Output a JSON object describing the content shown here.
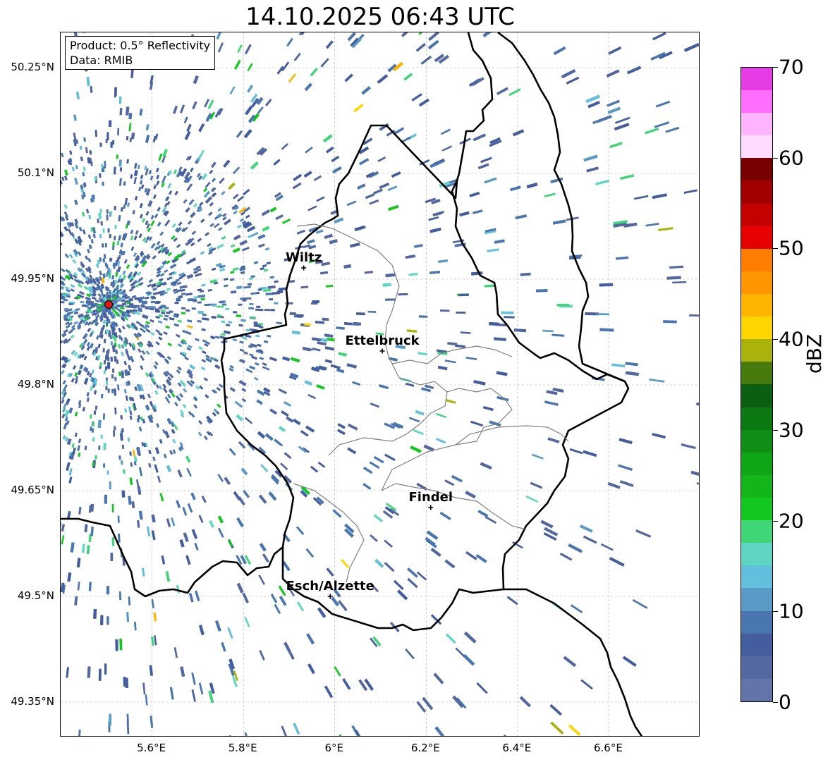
{
  "title": "14.10.2025 06:43 UTC",
  "info": {
    "product": "Product: 0.5° Reflectivity",
    "data": "Data: RMIB"
  },
  "map": {
    "lon_range": [
      5.4,
      6.8
    ],
    "lat_range": [
      49.3,
      50.3
    ],
    "lat_ticks": [
      {
        "value": 50.25,
        "label": "50.25°N"
      },
      {
        "value": 50.1,
        "label": "50.1°N"
      },
      {
        "value": 49.95,
        "label": "49.95°N"
      },
      {
        "value": 49.8,
        "label": "49.8°N"
      },
      {
        "value": 49.65,
        "label": "49.65°N"
      },
      {
        "value": 49.5,
        "label": "49.5°N"
      },
      {
        "value": 49.35,
        "label": "49.35°N"
      }
    ],
    "lon_ticks": [
      {
        "value": 5.6,
        "label": "5.6°E"
      },
      {
        "value": 5.8,
        "label": "5.8°E"
      },
      {
        "value": 6.0,
        "label": "6°E"
      },
      {
        "value": 6.2,
        "label": "6.2°E"
      },
      {
        "value": 6.4,
        "label": "6.4°E"
      },
      {
        "value": 6.6,
        "label": "6.6°E"
      }
    ],
    "radar_site": {
      "lon": 5.505,
      "lat": 49.914
    },
    "cities": [
      {
        "name": "Wiltz",
        "lon": 5.932,
        "lat": 49.966
      },
      {
        "name": "Ettelbruck",
        "lon": 6.104,
        "lat": 49.848
      },
      {
        "name": "Findel",
        "lon": 6.21,
        "lat": 49.626
      },
      {
        "name": "Esch/Alzette",
        "lon": 5.99,
        "lat": 49.5
      }
    ]
  },
  "colorbar": {
    "label": "dBZ",
    "min": 0,
    "max": 70,
    "ticks": [
      "0",
      "10",
      "20",
      "30",
      "40",
      "50",
      "60",
      "70"
    ],
    "colors": [
      "#6473a8",
      "#5367a0",
      "#435d9e",
      "#4a76b0",
      "#5a9ac6",
      "#62c0dc",
      "#5ed6c3",
      "#3fd677",
      "#12c81e",
      "#12b61a",
      "#10a417",
      "#0e8e14",
      "#0c7812",
      "#0a5f10",
      "#467a0c",
      "#aab20c",
      "#ffd600",
      "#ffb400",
      "#ff9600",
      "#ff7d00",
      "#e60000",
      "#c40000",
      "#a10000",
      "#780000",
      "#ffdcff",
      "#ffb4ff",
      "#ff6eff",
      "#e63ce6"
    ]
  }
}
